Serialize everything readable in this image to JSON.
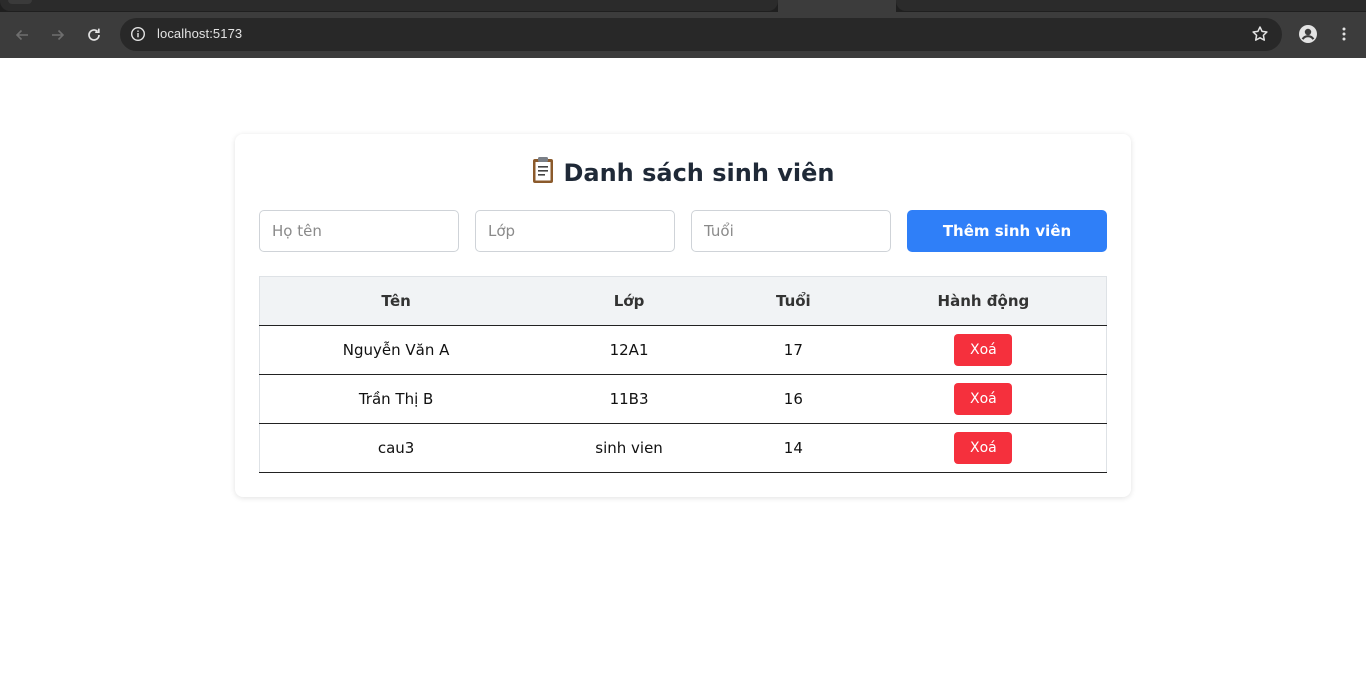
{
  "browser": {
    "url": "localhost:5173"
  },
  "page": {
    "title": "Danh sách sinh viên",
    "title_icon": "clipboard-icon",
    "form": {
      "name_placeholder": "Họ tên",
      "class_placeholder": "Lớp",
      "age_placeholder": "Tuổi",
      "add_label": "Thêm sinh viên"
    },
    "table": {
      "headers": [
        "Tên",
        "Lớp",
        "Tuổi",
        "Hành động"
      ],
      "rows": [
        {
          "name": "Nguyễn Văn A",
          "class": "12A1",
          "age": "17",
          "action": "Xoá"
        },
        {
          "name": "Trần Thị B",
          "class": "11B3",
          "age": "16",
          "action": "Xoá"
        },
        {
          "name": "cau3",
          "class": "sinh vien",
          "age": "14",
          "action": "Xoá"
        }
      ]
    }
  },
  "colors": {
    "primary": "#2f7ff8",
    "danger": "#f5303d",
    "header_bg": "#f1f3f5"
  }
}
